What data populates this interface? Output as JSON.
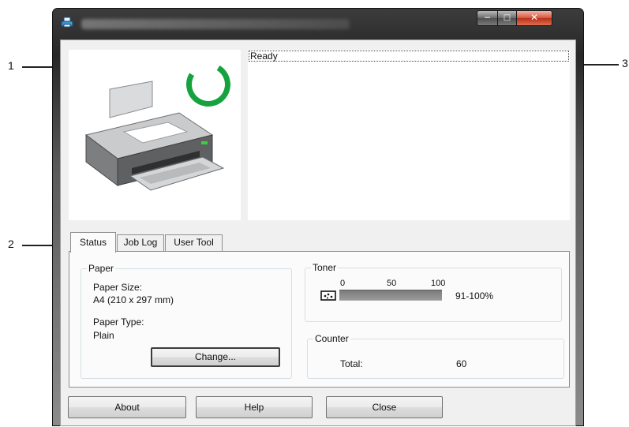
{
  "callouts": [
    "1",
    "2",
    "3"
  ],
  "status": {
    "text": "Ready"
  },
  "tabs": [
    {
      "label": "Status",
      "active": true
    },
    {
      "label": "Job Log",
      "active": false
    },
    {
      "label": "User Tool",
      "active": false
    }
  ],
  "paper": {
    "group_label": "Paper",
    "size_label": "Paper Size:",
    "size_value": "A4 (210 x 297 mm)",
    "type_label": "Paper Type:",
    "type_value": "Plain",
    "change_button": "Change..."
  },
  "toner": {
    "group_label": "Toner",
    "ticks": [
      "0",
      "50",
      "100"
    ],
    "level_percent": 100,
    "level_text": "91-100%"
  },
  "counter": {
    "group_label": "Counter",
    "total_label": "Total:",
    "total_value": "60"
  },
  "buttons": {
    "about": "About",
    "help": "Help",
    "close": "Close"
  },
  "icons": {
    "window": "printer-app-icon",
    "spinner": "ready-status-ring-icon",
    "toner": "toner-cartridge-icon"
  },
  "colors": {
    "status_ring": "#16a33e",
    "close_button": "#c8412a"
  }
}
